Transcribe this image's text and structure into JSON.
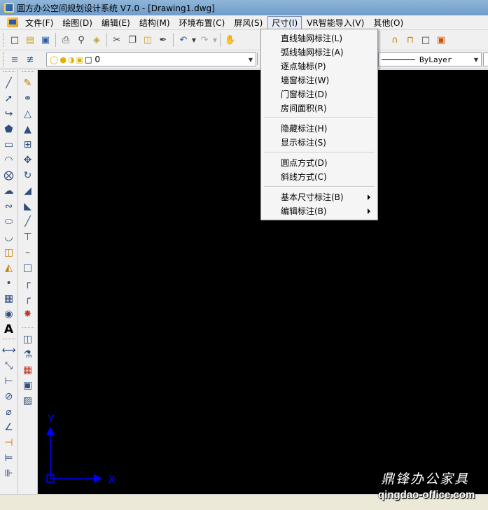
{
  "window": {
    "title": "圆方办公空间规划设计系统 V7.0 - [Drawing1.dwg]"
  },
  "menubar": {
    "items": [
      {
        "label": "文件(F)"
      },
      {
        "label": "绘图(D)"
      },
      {
        "label": "编辑(E)"
      },
      {
        "label": "结构(M)"
      },
      {
        "label": "环境布置(C)"
      },
      {
        "label": "屏风(S)"
      },
      {
        "label": "尺寸(I)"
      },
      {
        "label": "VR智能导入(V)"
      },
      {
        "label": "其他(O)"
      }
    ],
    "active_index": 6
  },
  "dropdown": {
    "groups": [
      [
        "直线轴网标注(L)",
        "弧线轴网标注(A)",
        "逐点轴标(P)",
        "墙窗标注(W)",
        "门窗标注(D)",
        "房间面积(R)"
      ],
      [
        "隐藏标注(H)",
        "显示标注(S)"
      ],
      [
        "圆点方式(D)",
        "斜线方式(C)"
      ],
      [
        "基本尺寸标注(B)",
        "编辑标注(B)"
      ]
    ],
    "submenu_items": [
      "基本尺寸标注(B)",
      "编辑标注(B)"
    ]
  },
  "layer_toolbar": {
    "layer_value": "0",
    "linetype_value": "ByLayer"
  },
  "canvas": {
    "background": "#000000",
    "ucs_x_label": "X",
    "ucs_y_label": "Y",
    "ucs_color": "#0000ff"
  },
  "watermark": {
    "brand": "鼎锋办公家具",
    "url": "qingdao-office.com"
  }
}
